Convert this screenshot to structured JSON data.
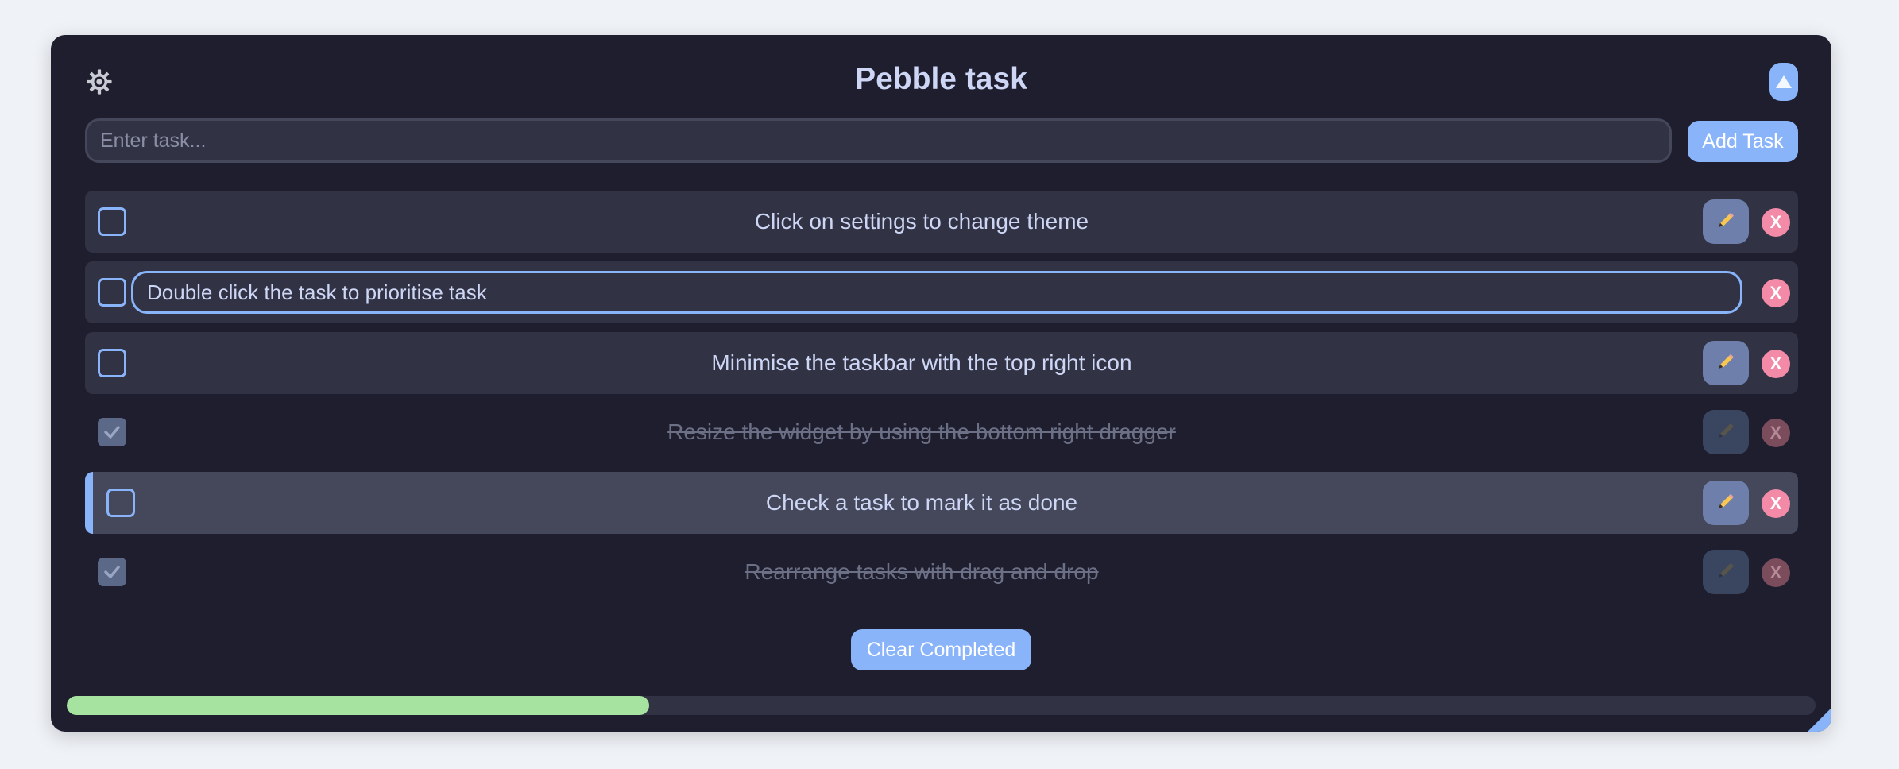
{
  "app": {
    "title": "Pebble task"
  },
  "add": {
    "placeholder": "Enter task...",
    "button_label": "Add Task"
  },
  "tasks": [
    {
      "text": "Click on settings to change theme",
      "done": false,
      "state": "normal"
    },
    {
      "text": "Double click the task to prioritise task",
      "done": false,
      "state": "editing"
    },
    {
      "text": "Minimise the taskbar with the top right icon",
      "done": false,
      "state": "normal"
    },
    {
      "text": "Resize the widget by using the bottom right dragger",
      "done": true,
      "state": "done"
    },
    {
      "text": "Check a task to mark it as done",
      "done": false,
      "state": "selected"
    },
    {
      "text": "Rearrange tasks with drag and drop",
      "done": true,
      "state": "done"
    }
  ],
  "delete_label": "X",
  "clear_label": "Clear Completed",
  "progress": {
    "fraction": 0.333
  },
  "colors": {
    "accent": "#89b4fa",
    "background": "#1e1e2e",
    "danger": "#f38ba8",
    "progress": "#a6e3a1"
  },
  "icons": {
    "settings": "gear-icon",
    "minimize": "triangle-up-icon",
    "edit": "pencil-icon",
    "check": "checkmark-icon",
    "resize": "resize-corner-icon"
  }
}
